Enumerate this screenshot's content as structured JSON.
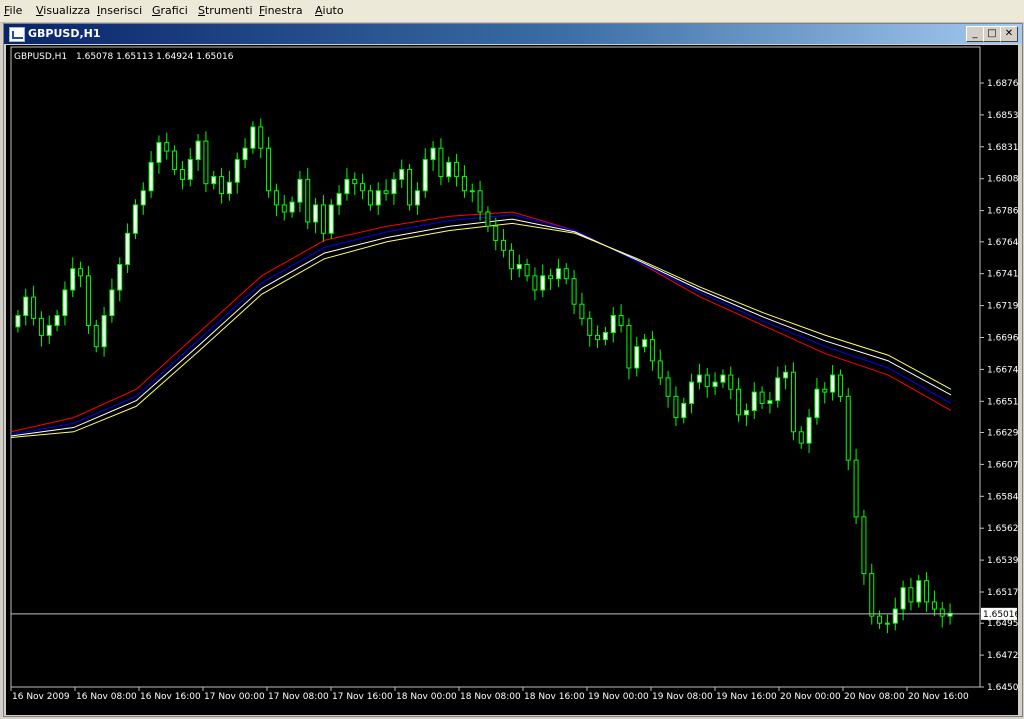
{
  "menu": {
    "items": [
      {
        "first": "F",
        "rest": "ile"
      },
      {
        "first": "V",
        "rest": "isualizza"
      },
      {
        "first": "I",
        "rest": "nserisci"
      },
      {
        "first": "G",
        "rest": "rafici"
      },
      {
        "first": "S",
        "rest": "trumenti"
      },
      {
        "first": "F",
        "rest": "inestra"
      },
      {
        "first": "A",
        "rest": "iuto"
      }
    ]
  },
  "window": {
    "title": "GBPUSD,H1",
    "minimize_icon": "minimize-icon",
    "restore_icon": "restore-icon",
    "close_icon": "close-icon"
  },
  "chart_data": {
    "type": "candlestick",
    "symbol_label": "GBPUSD,H1",
    "ohlc_label": "1.65078 1.65113 1.64924 1.65016",
    "current_price": "1.65016",
    "y_ticks": [
      "1.68760",
      "1.68535",
      "1.68310",
      "1.68085",
      "1.67860",
      "1.67640",
      "1.67415",
      "1.67190",
      "1.66965",
      "1.66740",
      "1.66515",
      "1.66295",
      "1.66070",
      "1.65845",
      "1.65620",
      "1.65395",
      "1.65170",
      "1.64950",
      "1.64725",
      "1.64500"
    ],
    "x_ticks": [
      "16 Nov 2009",
      "16 Nov 08:00",
      "16 Nov 16:00",
      "17 Nov 00:00",
      "17 Nov 08:00",
      "17 Nov 16:00",
      "18 Nov 00:00",
      "18 Nov 08:00",
      "18 Nov 16:00",
      "19 Nov 00:00",
      "19 Nov 08:00",
      "19 Nov 16:00",
      "20 Nov 00:00",
      "20 Nov 08:00",
      "20 Nov 16:00"
    ],
    "ylim": [
      1.645,
      1.6876
    ],
    "candle_close": [
      1.6712,
      1.6725,
      1.671,
      1.6698,
      1.6705,
      1.6712,
      1.673,
      1.6745,
      1.674,
      1.6705,
      1.669,
      1.6712,
      1.673,
      1.6748,
      1.677,
      1.679,
      1.68,
      1.682,
      1.6834,
      1.6828,
      1.6815,
      1.6808,
      1.6822,
      1.6835,
      1.6805,
      1.681,
      1.6798,
      1.6806,
      1.6822,
      1.683,
      1.6845,
      1.683,
      1.68,
      1.679,
      1.6785,
      1.6792,
      1.6808,
      1.6778,
      1.679,
      1.677,
      1.679,
      1.6798,
      1.6808,
      1.6805,
      1.68,
      1.679,
      1.68,
      1.6798,
      1.6808,
      1.6815,
      1.679,
      1.68,
      1.6822,
      1.683,
      1.681,
      1.682,
      1.681,
      1.68,
      1.68,
      1.6785,
      1.6775,
      1.6765,
      1.6758,
      1.6745,
      1.6748,
      1.674,
      1.673,
      1.674,
      1.6738,
      1.6745,
      1.6738,
      1.672,
      1.671,
      1.6698,
      1.6695,
      1.67,
      1.6712,
      1.6705,
      1.6675,
      1.669,
      1.6695,
      1.668,
      1.6668,
      1.6655,
      1.664,
      1.665,
      1.6665,
      1.667,
      1.6662,
      1.6665,
      1.667,
      1.666,
      1.6642,
      1.6645,
      1.6658,
      1.665,
      1.6652,
      1.6668,
      1.6672,
      1.663,
      1.6622,
      1.664,
      1.666,
      1.6658,
      1.667,
      1.6655,
      1.661,
      1.657,
      1.653,
      1.65,
      1.6495,
      1.6495,
      1.6505,
      1.652,
      1.651,
      1.6525,
      1.651,
      1.6505,
      1.65,
      1.6502
    ],
    "ma_lines": [
      {
        "color": "#ff0000",
        "values": [
          1.663,
          1.664,
          1.666,
          1.67,
          1.674,
          1.6765,
          1.6775,
          1.6782,
          1.6785,
          1.6772,
          1.675,
          1.6725,
          1.6705,
          1.6685,
          1.667,
          1.6645
        ]
      },
      {
        "color": "#0000ff",
        "values": [
          1.6628,
          1.6636,
          1.6655,
          1.6695,
          1.6735,
          1.676,
          1.6771,
          1.6779,
          1.6783,
          1.6772,
          1.675,
          1.6728,
          1.6708,
          1.669,
          1.6675,
          1.665
        ]
      },
      {
        "color": "#ffffff",
        "values": [
          1.6627,
          1.6633,
          1.6652,
          1.6691,
          1.6731,
          1.6756,
          1.6767,
          1.6775,
          1.678,
          1.6771,
          1.6751,
          1.673,
          1.6711,
          1.6694,
          1.668,
          1.6656
        ]
      },
      {
        "color": "#ffff66",
        "values": [
          1.6626,
          1.663,
          1.6648,
          1.6687,
          1.6727,
          1.6752,
          1.6764,
          1.6772,
          1.6777,
          1.677,
          1.6752,
          1.6732,
          1.6714,
          1.6698,
          1.6684,
          1.666
        ]
      }
    ],
    "colors": {
      "background": "#000000",
      "bull_candle": "#ffffff",
      "bear_candle": "#000000",
      "wick": "#00ff00",
      "axis_text": "#ffffff",
      "price_line": "#c0c0c0"
    }
  }
}
